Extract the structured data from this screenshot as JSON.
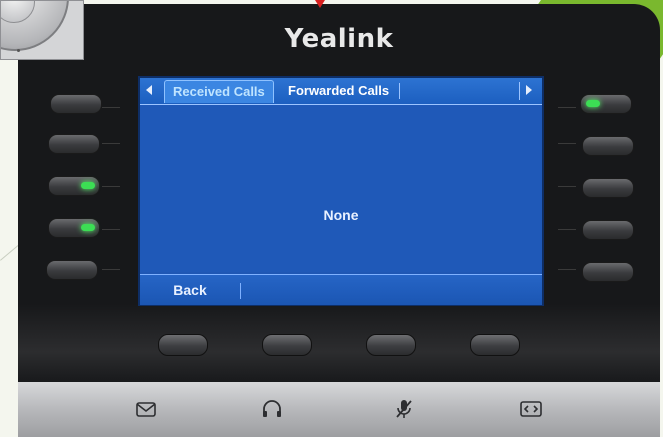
{
  "device": {
    "brand": "Yealink"
  },
  "screen": {
    "tabs": [
      {
        "label": "Received Calls",
        "active": true
      },
      {
        "label": "Forwarded Calls",
        "active": false
      }
    ],
    "empty_message": "None",
    "softkeys": [
      "Back"
    ]
  },
  "line_keys": {
    "left_leds": [
      false,
      false,
      true,
      true,
      false
    ],
    "right_leds": [
      true,
      false,
      false,
      false,
      false
    ]
  },
  "function_keys": [
    {
      "icon": "message-icon"
    },
    {
      "icon": "headset-icon"
    },
    {
      "icon": "mute-icon"
    },
    {
      "icon": "transfer-icon"
    }
  ],
  "colors": {
    "screen_blue": "#1f57b4",
    "led_green": "#3cde54"
  }
}
